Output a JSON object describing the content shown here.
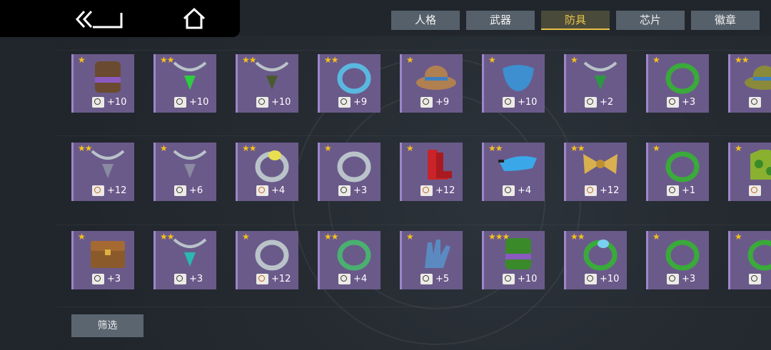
{
  "tabs": [
    {
      "label": "人格",
      "active": false
    },
    {
      "label": "武器",
      "active": false
    },
    {
      "label": "防具",
      "active": true
    },
    {
      "label": "芯片",
      "active": false
    },
    {
      "label": "徽章",
      "active": false
    }
  ],
  "filter_label": "筛选",
  "colors": {
    "accent": "#e8c34a",
    "slot": "#6a5a8a",
    "star": "#f4c21a"
  },
  "items": [
    {
      "icon": "armband-icon",
      "stars": "★",
      "level": "+10",
      "badge": "circle"
    },
    {
      "icon": "green-gem-necklace-icon",
      "stars": "★★",
      "level": "+10",
      "badge": "circle"
    },
    {
      "icon": "dark-pendant-necklace-icon",
      "stars": "★★",
      "level": "+10",
      "badge": "circle"
    },
    {
      "icon": "blue-bangle-icon",
      "stars": "★★",
      "level": "+9",
      "badge": "circle"
    },
    {
      "icon": "straw-hat-icon",
      "stars": "★",
      "level": "+9",
      "badge": "circle"
    },
    {
      "icon": "face-mask-icon",
      "stars": "★",
      "level": "+10",
      "badge": "circle"
    },
    {
      "icon": "camo-necklace-icon",
      "stars": "★",
      "level": "+2",
      "badge": "circle"
    },
    {
      "icon": "camo-ring-icon",
      "stars": "★",
      "level": "+3",
      "badge": "circle"
    },
    {
      "icon": "camo-hat-icon",
      "stars": "★★",
      "level": "",
      "badge": "circle"
    },
    {
      "icon": "silver-necklace-icon",
      "stars": "★★",
      "level": "+12",
      "badge": "orange"
    },
    {
      "icon": "triangle-pendant-icon",
      "stars": "★",
      "level": "+6",
      "badge": "circle"
    },
    {
      "icon": "yellow-gem-ring-icon",
      "stars": "★★",
      "level": "+4",
      "badge": "orange"
    },
    {
      "icon": "silver-ring-icon",
      "stars": "★",
      "level": "+3",
      "badge": "circle"
    },
    {
      "icon": "red-boots-icon",
      "stars": "★",
      "level": "+12",
      "badge": "orange"
    },
    {
      "icon": "blue-visor-icon",
      "stars": "★★",
      "level": "+4",
      "badge": "circle"
    },
    {
      "icon": "yellow-bow-icon",
      "stars": "★★",
      "level": "+12",
      "badge": "orange"
    },
    {
      "icon": "camo-bracelet-icon",
      "stars": "★",
      "level": "+1",
      "badge": "circle"
    },
    {
      "icon": "camo-shirt-icon",
      "stars": "★",
      "level": "",
      "badge": "orange"
    },
    {
      "icon": "treasure-chest-icon",
      "stars": "★",
      "level": "+3",
      "badge": "circle"
    },
    {
      "icon": "teal-gem-necklace-icon",
      "stars": "★★",
      "level": "+3",
      "badge": "circle"
    },
    {
      "icon": "plain-ring-icon",
      "stars": "★",
      "level": "+12",
      "badge": "orange"
    },
    {
      "icon": "green-band-ring-icon",
      "stars": "★★",
      "level": "+4",
      "badge": "circle"
    },
    {
      "icon": "blue-gloves-icon",
      "stars": "★",
      "level": "+5",
      "badge": "circle"
    },
    {
      "icon": "camo-armband-icon",
      "stars": "★★★",
      "level": "+10",
      "badge": "circle"
    },
    {
      "icon": "camo-gem-ring-icon",
      "stars": "★★",
      "level": "+10",
      "badge": "circle"
    },
    {
      "icon": "camo-thin-ring-icon",
      "stars": "★",
      "level": "+3",
      "badge": "circle"
    },
    {
      "icon": "dark-camo-ring-icon",
      "stars": "★",
      "level": "",
      "badge": "circle"
    }
  ]
}
